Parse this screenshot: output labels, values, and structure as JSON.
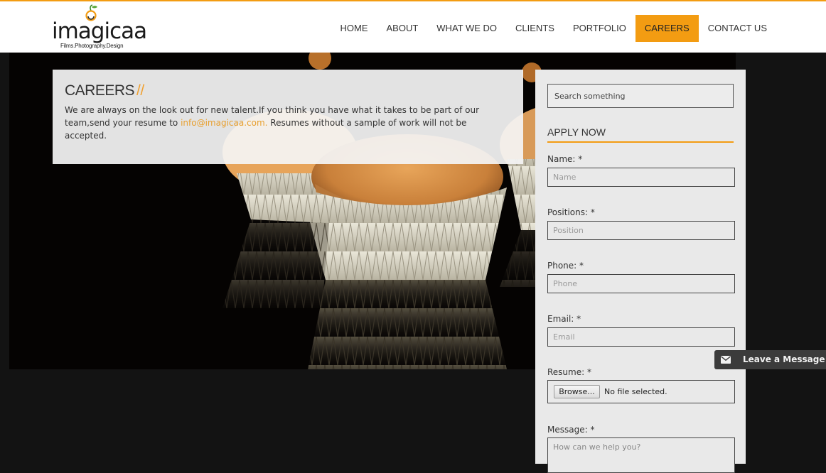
{
  "brand": {
    "logo_text": "imagicaa",
    "tagline": "Films.Photography.Design"
  },
  "nav": {
    "items": [
      {
        "label": "HOME"
      },
      {
        "label": "ABOUT"
      },
      {
        "label": "WHAT WE DO"
      },
      {
        "label": "CLIENTS"
      },
      {
        "label": "PORTFOLIO"
      },
      {
        "label": "CAREERS",
        "active": true
      },
      {
        "label": "CONTACT US"
      }
    ]
  },
  "careers": {
    "title": "CAREERS",
    "title_suffix": "//",
    "text_before": "We are always on the look out for new talent.If you think you have what it takes to be part of our team,send your resume to ",
    "email": "info@imagicaa.com.",
    "text_after": " Resumes without a sample of work will not be accepted."
  },
  "sidebar": {
    "search_placeholder": "Search something",
    "apply_title": "APPLY NOW",
    "fields": {
      "name": {
        "label": "Name: *",
        "placeholder": "Name"
      },
      "position": {
        "label": "Positions: *",
        "placeholder": "Position"
      },
      "phone": {
        "label": "Phone: *",
        "placeholder": "Phone"
      },
      "email": {
        "label": "Email: *",
        "placeholder": "Email"
      },
      "resume": {
        "label": "Resume: *",
        "button": "Browse...",
        "status": "No file selected."
      },
      "message": {
        "label": "Message: *",
        "placeholder": "How can we help you?"
      }
    }
  },
  "chat": {
    "label": "Leave a Message",
    "icon": "envelope-icon"
  },
  "colors": {
    "accent": "#f39c12",
    "email_link": "#e8a030",
    "page_background": "#131313",
    "sidebar_background": "#e9e9e9"
  }
}
